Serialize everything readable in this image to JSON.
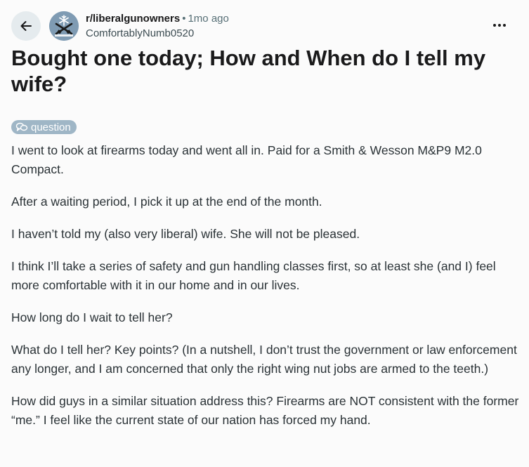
{
  "post": {
    "subreddit": "r/liberalgunowners",
    "separator": "•",
    "age": "1mo ago",
    "author": "ComfortablyNumb0520",
    "title": "Bought one today; How and When do I tell my wife?",
    "flair": "question",
    "paragraphs": [
      "I went to look at firearms today and went all in. Paid for a Smith & Wesson M&P9 M2.0 Compact.",
      "After a waiting period, I pick it up at the end of the month.",
      "I haven’t told my (also very liberal) wife. She will not be pleased.",
      "I think I’ll take a series of safety and gun handling classes first, so at least she (and I) feel more comfortable with it in our home and in our lives.",
      "How long do I wait to tell her?",
      "What do I tell her? Key points? (In a nutshell, I don’t trust the government or law enforcement any longer, and I am concerned that only the right wing nut jobs are armed to the teeth.)",
      "How did guys in a similar situation address this? Firearms are NOT consistent with the former “me.” I feel like the current state of our nation has forced my hand."
    ]
  },
  "icons": {
    "back": "arrow-left-icon",
    "more": "more-horizontal-icon",
    "flair": "chat-bubbles-icon",
    "avatar": "community-avatar-icon"
  },
  "colors": {
    "background": "#fbfbfb",
    "flair_bg": "#9fb6c6",
    "back_btn_bg": "#e5ebee",
    "avatar_bg": "#7f9bb3"
  }
}
